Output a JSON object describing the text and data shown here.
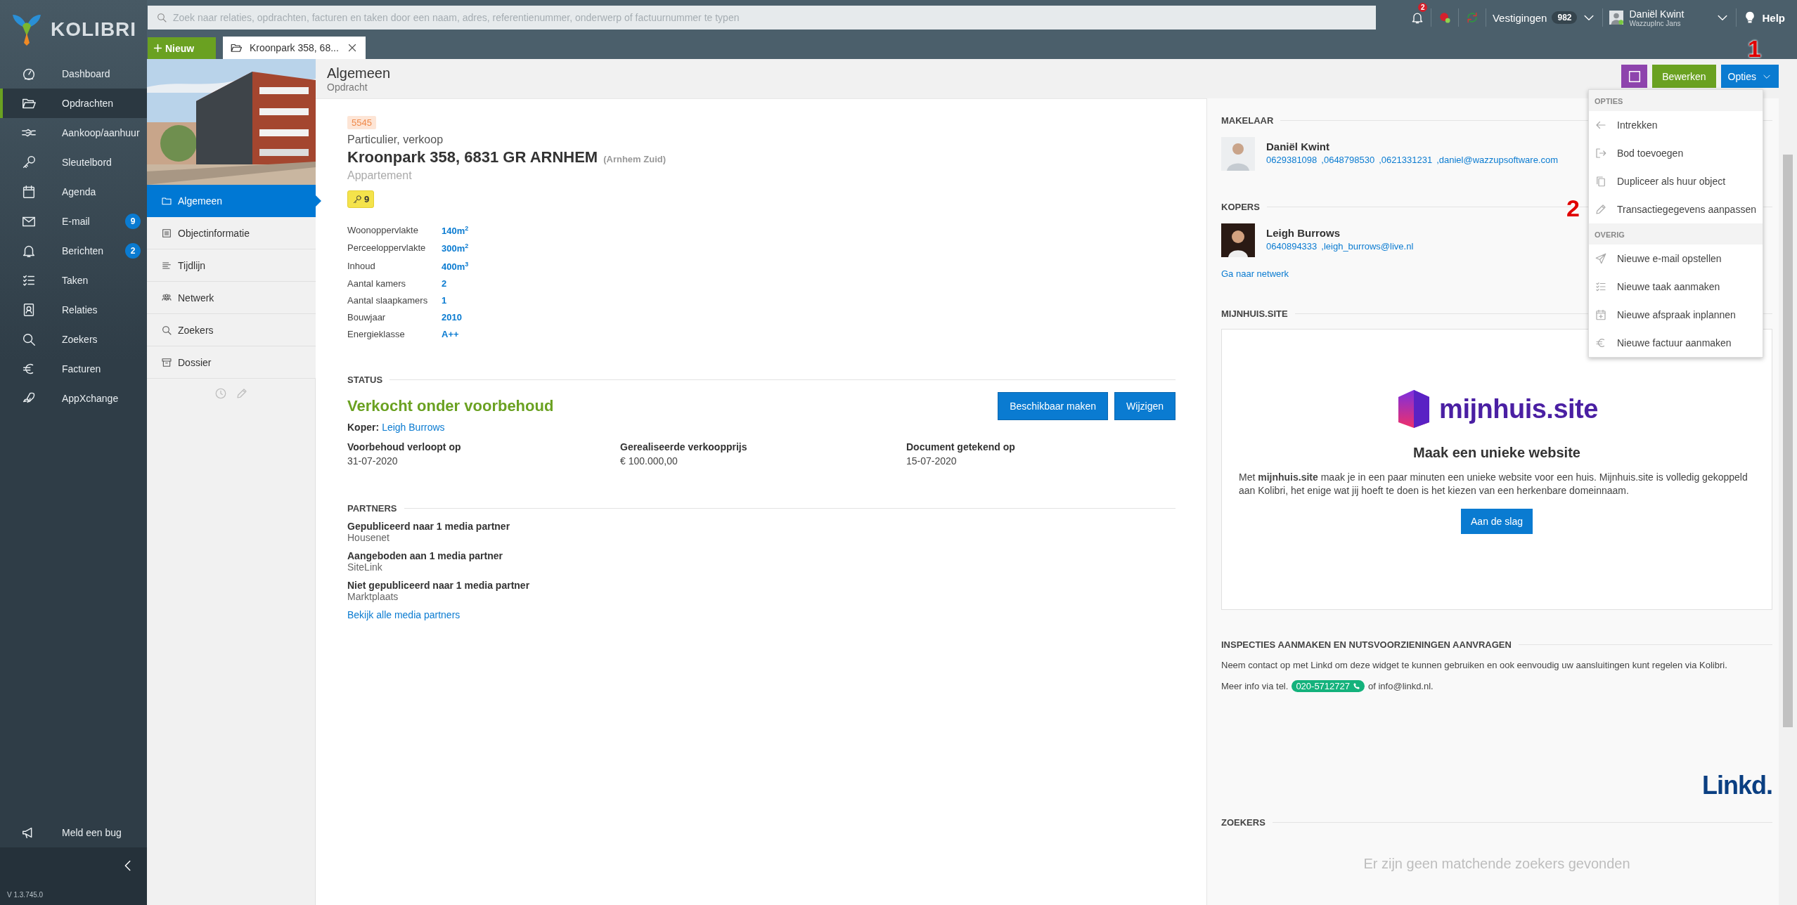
{
  "app": {
    "name": "KOLIBRI",
    "version": "V 1.3.745.0"
  },
  "topbar": {
    "search": {
      "placeholder": "Zoek naar relaties, opdrachten, facturen en taken door een naam, adres, referentienummer, onderwerp of factuurnummer te typen"
    },
    "notifications": "2",
    "branches": {
      "label": "Vestigingen",
      "count": "982"
    },
    "user": {
      "name": "Daniël Kwint",
      "company": "WazzupInc Jans"
    },
    "help": "Help"
  },
  "sidebar": {
    "items": [
      {
        "label": "Dashboard",
        "selected": false
      },
      {
        "label": "Opdrachten",
        "selected": true
      },
      {
        "label": "Aankoop/aanhuur",
        "selected": false
      },
      {
        "label": "Sleutelbord",
        "selected": false
      },
      {
        "label": "Agenda",
        "selected": false
      },
      {
        "label": "E-mail",
        "selected": false,
        "badge": "9"
      },
      {
        "label": "Berichten",
        "selected": false,
        "badge": "2"
      },
      {
        "label": "Taken",
        "selected": false
      },
      {
        "label": "Relaties",
        "selected": false
      },
      {
        "label": "Zoekers",
        "selected": false
      },
      {
        "label": "Facturen",
        "selected": false
      },
      {
        "label": "AppXchange",
        "selected": false
      }
    ],
    "bug_report": "Meld een bug"
  },
  "new_button": "Nieuw",
  "tabs": [
    {
      "label": "Kroonpark 358, 68...",
      "selected": true
    }
  ],
  "record_nav": {
    "items": [
      {
        "label": "Algemeen",
        "selected": true
      },
      {
        "label": "Objectinformatie",
        "selected": false
      },
      {
        "label": "Tijdlijn",
        "selected": false
      },
      {
        "label": "Netwerk",
        "selected": false
      },
      {
        "label": "Zoekers",
        "selected": false
      },
      {
        "label": "Dossier",
        "selected": false
      }
    ]
  },
  "header": {
    "title": "Algemeen",
    "subtitle": "Opdracht",
    "edit_button": "Bewerken",
    "options_button": "Opties"
  },
  "object": {
    "reference": "5545",
    "type": "Particulier, verkoop",
    "address": "Kroonpark 358, 6831 GR ARNHEM",
    "district": "(Arnhem Zuid)",
    "property_type": "Appartement",
    "keys": "9",
    "specs": [
      {
        "label": "Woonoppervlakte",
        "value": "140m$^{2}$"
      },
      {
        "label": "Perceeloppervlakte",
        "value": "300m$^{2}$"
      },
      {
        "label": "Inhoud",
        "value": "400m$^{3}$"
      },
      {
        "label": "Aantal kamers",
        "value": "2"
      },
      {
        "label": "Aantal slaapkamers",
        "value": "1"
      },
      {
        "label": "Bouwjaar",
        "value": "2010"
      },
      {
        "label": "Energieklasse",
        "value": "A++"
      }
    ]
  },
  "status": {
    "heading": "STATUS",
    "state": "Verkocht onder voorbehoud",
    "buttons": [
      "Beschikbaar maken",
      "Wijzigen"
    ],
    "buyer_label": "Koper:",
    "buyer": "Leigh Burrows",
    "facts": [
      {
        "label": "Voorbehoud verloopt op",
        "value": "31-07-2020"
      },
      {
        "label": "Gerealiseerde verkoopprijs",
        "value": "€ 100.000,00"
      },
      {
        "label": "Document getekend op",
        "value": "15-07-2020"
      }
    ]
  },
  "partners": {
    "heading": "PARTNERS",
    "items": [
      {
        "title": "Gepubliceerd naar 1 media partner",
        "name": "Housenet"
      },
      {
        "title": "Aangeboden aan 1 media partner",
        "name": "SiteLink"
      },
      {
        "title": "Niet gepubliceerd naar 1 media partner",
        "name": "Marktplaats"
      }
    ],
    "link": "Bekijk alle media partners"
  },
  "makelaar": {
    "heading": "MAKELAAR",
    "name": "Daniël Kwint",
    "contacts": [
      "0629381098",
      ",0648798530",
      ",0621331231",
      ",daniel@wazzupsoftware.com"
    ]
  },
  "kopers": {
    "heading": "KOPERS",
    "name": "Leigh Burrows",
    "contacts": [
      "0640894333",
      ",leigh_burrows@live.nl"
    ],
    "link": "Ga naar netwerk"
  },
  "mijnhuis": {
    "heading": "MIJNHUIS.SITE",
    "logo": "mijnhuis.site",
    "title": "Maak een unieke website",
    "text": "Met **mijnhuis.site** maak je in een paar minuten een unieke website voor een huis. Mijnhuis.site is volledig gekoppeld aan Kolibri, het enige wat jij hoeft te doen is het kiezen van een herkenbare domeinnaam.",
    "button": "Aan de slag"
  },
  "inspecties": {
    "heading": "INSPECTIES AANMAKEN EN NUTSVOORZIENINGEN AANVRAGEN",
    "text": "Neem contact op met Linkd om deze widget te kunnen gebruiken en ook eenvoudig uw aansluitingen kunt regelen via Kolibri.",
    "info_prefix": "Meer info via tel.",
    "phone": "020-5712727",
    "info_suffix": "of info@linkd.nl.",
    "logo": "Linkd."
  },
  "zoekers": {
    "heading": "ZOEKERS",
    "empty": "Er zijn geen matchende zoekers gevonden"
  },
  "dropdown": {
    "sections": [
      {
        "title": "OPTIES",
        "items": [
          "Intrekken",
          "Bod toevoegen",
          "Dupliceer als huur object",
          "Transactiegegevens aanpassen"
        ]
      },
      {
        "title": "OVERIG",
        "items": [
          "Nieuwe e-mail opstellen",
          "Nieuwe taak aanmaken",
          "Nieuwe afspraak inplannen",
          "Nieuwe factuur aanmaken"
        ]
      }
    ]
  },
  "annotations": [
    {
      "label": "1"
    },
    {
      "label": "2"
    }
  ]
}
